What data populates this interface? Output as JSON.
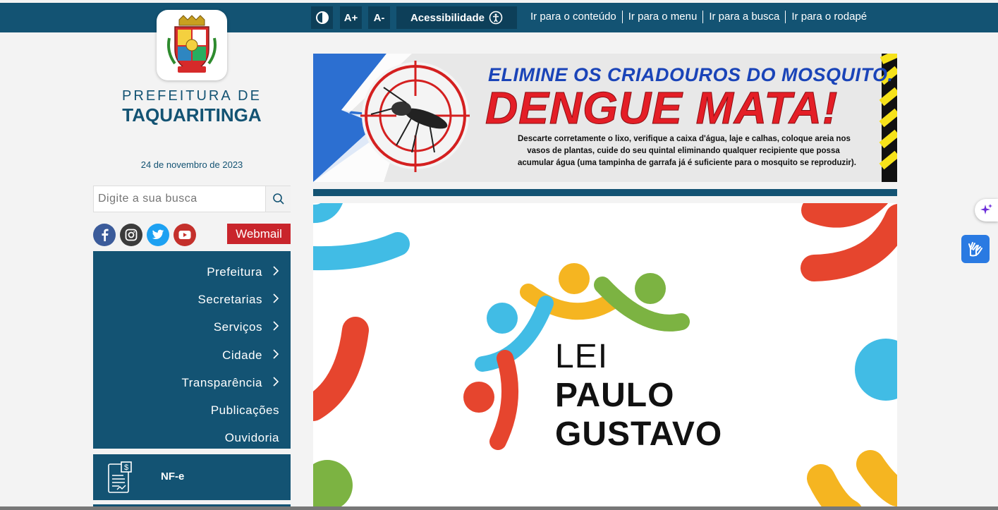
{
  "topbar": {
    "contrast_icon": "contrast-icon",
    "font_increase": "A+",
    "font_decrease": "A-",
    "accessibility_label": "Acessibilidade",
    "skip_links": [
      "Ir para o conteúdo",
      "Ir para o menu",
      "Ir para a busca",
      "Ir para o rodapé"
    ]
  },
  "header": {
    "prefix": "PREFEITURA DE",
    "city": "TAQUARITINGA",
    "date": "24 de novembro de 2023"
  },
  "search": {
    "placeholder": "Digite a sua busca"
  },
  "social": [
    "facebook-icon",
    "instagram-icon",
    "twitter-icon",
    "youtube-icon"
  ],
  "webmail_label": "Webmail",
  "menu": {
    "items": [
      {
        "label": "Prefeitura",
        "has_submenu": true
      },
      {
        "label": "Secretarias",
        "has_submenu": true
      },
      {
        "label": "Serviços",
        "has_submenu": true
      },
      {
        "label": "Cidade",
        "has_submenu": true
      },
      {
        "label": "Transparência",
        "has_submenu": true
      },
      {
        "label": "Publicações",
        "has_submenu": false
      },
      {
        "label": "Ouvidoria",
        "has_submenu": false
      }
    ]
  },
  "nfe": {
    "label": "NF-e"
  },
  "banner": {
    "line1": "ELIMINE OS CRIADOUROS DO MOSQUITO.",
    "line2": "DENGUE MATA!",
    "body": [
      "Descarte corretamente o lixo, verifique a caixa d'água, laje e calhas, coloque areia nos",
      "vasos de plantas, cuide do seu quintal eliminando qualquer recipiente que possa",
      "acumular água (uma tampinha de garrafa já é suficiente para o mosquito se reproduzir)."
    ]
  },
  "poster": {
    "line1": "LEI",
    "line2": "PAULO",
    "line3": "GUSTAVO"
  },
  "colors": {
    "primary": "#135373",
    "webmail": "#c9252c",
    "banner_blue": "#2c6fd1",
    "banner_red": "#e41e26"
  }
}
